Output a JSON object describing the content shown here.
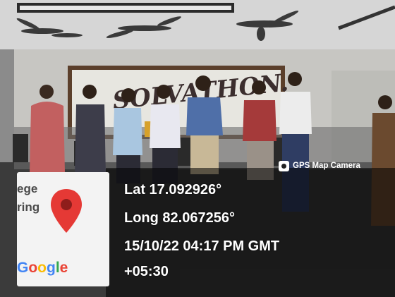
{
  "photo": {
    "description_icon": "event-photo",
    "banner_text": "SOLVATHON."
  },
  "camera_app": {
    "name": "GPS Map Camera",
    "icon": "camera-icon"
  },
  "location": {
    "lat": "Lat 17.092926°",
    "long": "Long 82.067256°",
    "datetime": "15/10/22 04:17 PM GMT",
    "timezone": "+05:30"
  },
  "map_thumb": {
    "partial_label_1": "ege",
    "partial_label_2": "ring",
    "logo": "Google",
    "logo_colors": [
      "#4285F4",
      "#EA4335",
      "#FBBC05",
      "#4285F4",
      "#34A853",
      "#EA4335"
    ],
    "pin_color": "#E53935"
  }
}
